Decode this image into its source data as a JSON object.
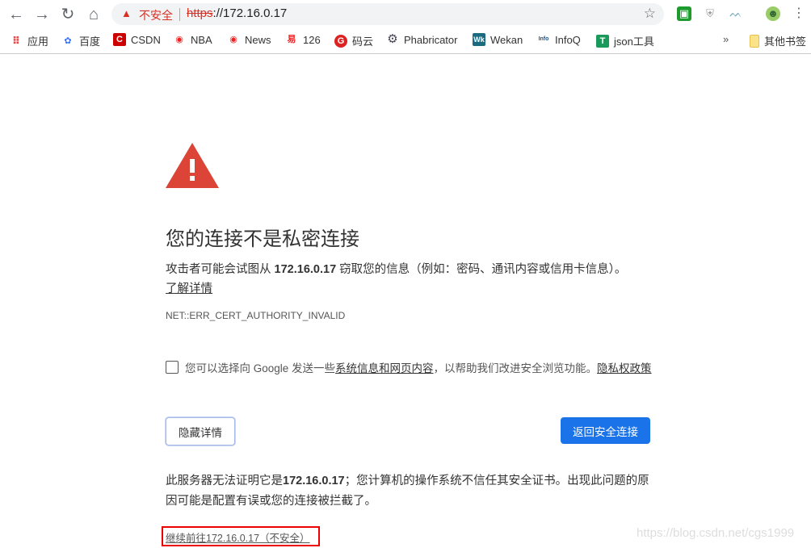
{
  "browser": {
    "insecure_label": "不安全",
    "url_scheme": "https",
    "url_rest": "://172.16.0.17",
    "bookmarks": [
      {
        "label": "应用",
        "icon": "apps-grid-icon"
      },
      {
        "label": "百度",
        "icon": "baidu-paw-icon"
      },
      {
        "label": "CSDN",
        "icon": "csdn-icon"
      },
      {
        "label": "NBA",
        "icon": "weibo-icon"
      },
      {
        "label": "News",
        "icon": "weibo-icon"
      },
      {
        "label": "126",
        "icon": "netease-icon"
      },
      {
        "label": "码云",
        "icon": "gitee-icon"
      },
      {
        "label": "Phabricator",
        "icon": "phabricator-gear-icon"
      },
      {
        "label": "Wekan",
        "icon": "wekan-icon"
      },
      {
        "label": "InfoQ",
        "icon": "infoq-icon"
      },
      {
        "label": "json工具",
        "icon": "json-tool-icon"
      }
    ],
    "overflow": "»",
    "other_bookmarks": "其他书签"
  },
  "page": {
    "title": "您的连接不是私密连接",
    "para1_pre": "攻击者可能会试图从 ",
    "para1_host": "172.16.0.17",
    "para1_post": " 窃取您的信息（例如：密码、通讯内容或信用卡信息）。",
    "learn_more": "了解详情",
    "error_code": "NET::ERR_CERT_AUTHORITY_INVALID",
    "checkbox_pre": "您可以选择向 Google 发送一些",
    "checkbox_link1": "系统信息和网页内容",
    "checkbox_mid": "，以帮助我们改进安全浏览功能。",
    "checkbox_link2": "隐私权政策",
    "hide_details": "隐藏详情",
    "back_to_safety": "返回安全连接",
    "para2_pre": "此服务器无法证明它是",
    "para2_host": "172.16.0.17",
    "para2_post": "；您计算机的操作系统不信任其安全证书。出现此问题的原因可能是配置有误或您的连接被拦截了。",
    "proceed_link": "继续前往172.16.0.17（不安全）",
    "watermark": "https://blog.csdn.net/cgs1999"
  },
  "colors": {
    "warning": "#d93025",
    "primary": "#1a73e8",
    "highlight_box": "#ee0000"
  }
}
